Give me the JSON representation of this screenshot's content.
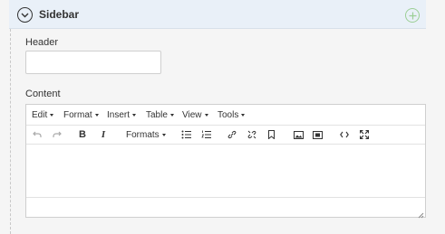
{
  "panel": {
    "title": "Sidebar",
    "collapse_icon": "chevron-down-circle-icon",
    "add_icon": "plus-circle-icon",
    "add_icon_color": "#9ccf96"
  },
  "fields": {
    "header_label": "Header",
    "header_value": "",
    "content_label": "Content"
  },
  "editor": {
    "menus": [
      "Edit",
      "Format",
      "Insert",
      "Table",
      "View",
      "Tools"
    ],
    "formats_label": "Formats",
    "toolbar_icons": [
      "undo-icon",
      "redo-icon",
      "bold-icon",
      "italic-icon",
      "formats-dropdown",
      "bullet-list-icon",
      "numbered-list-icon",
      "link-icon",
      "unlink-icon",
      "bookmark-icon",
      "image-icon",
      "media-icon",
      "code-icon",
      "fullscreen-icon"
    ],
    "bold_glyph": "B",
    "italic_glyph": "I"
  }
}
